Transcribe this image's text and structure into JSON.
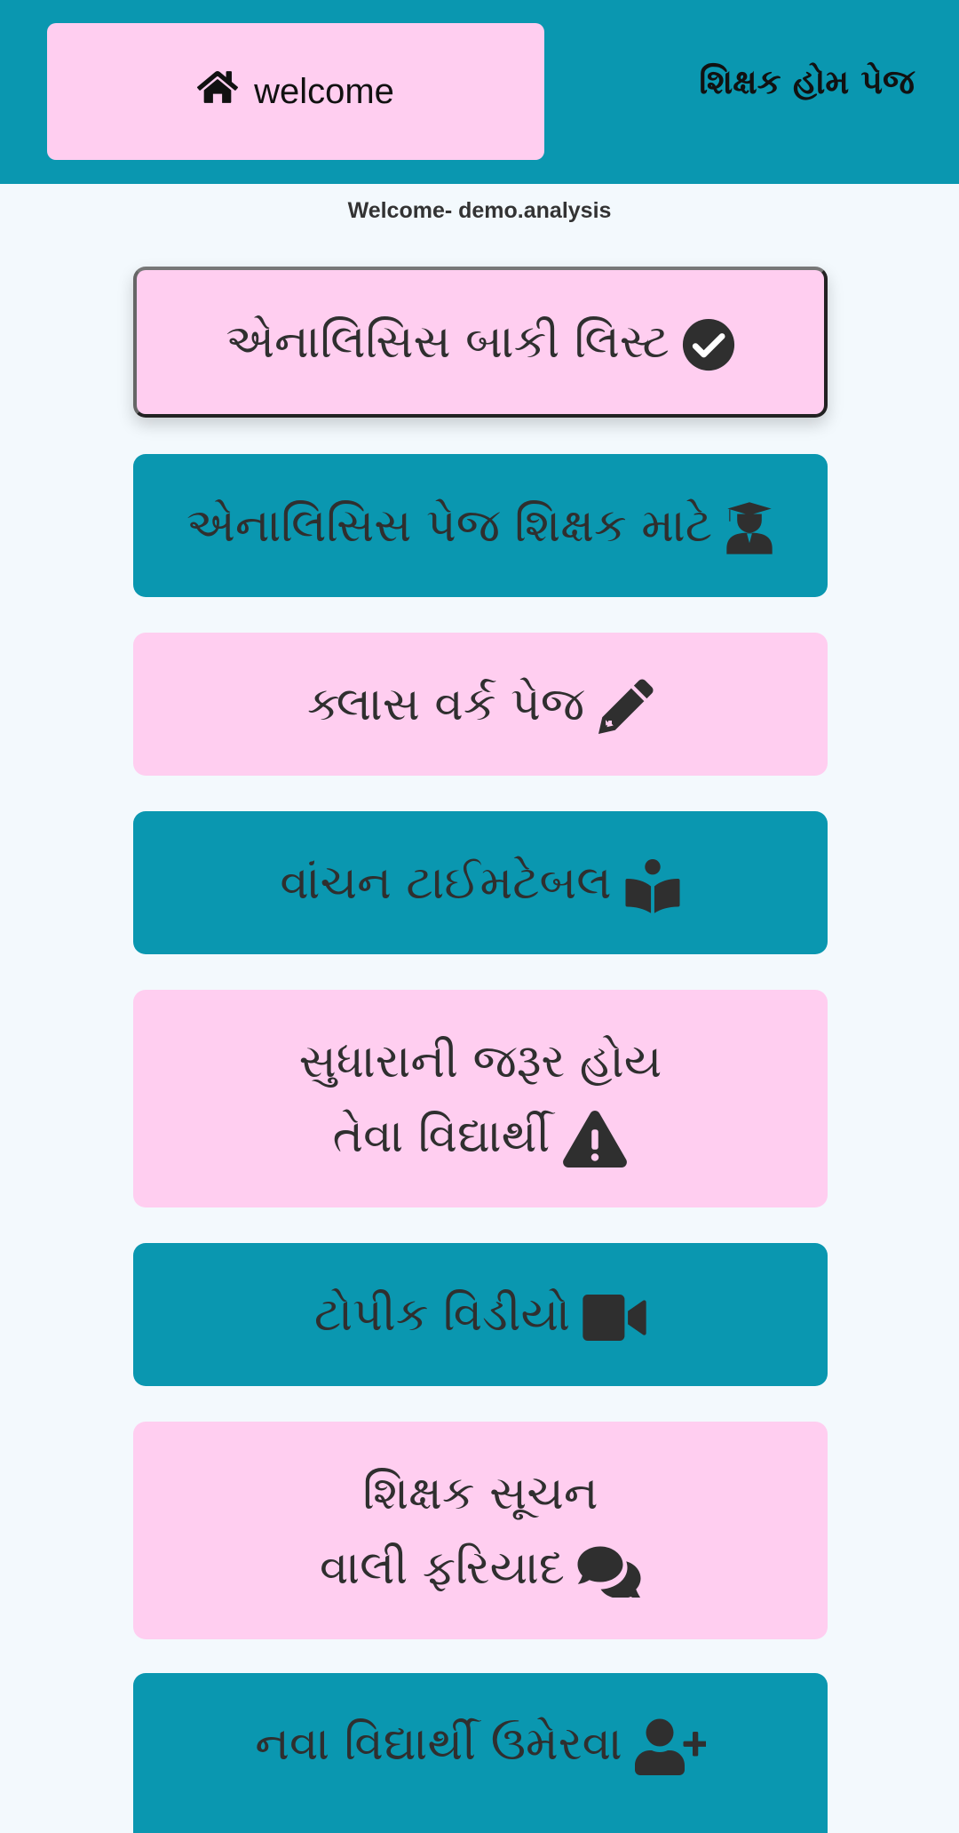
{
  "header": {
    "home_label": "welcome",
    "page_title": "શિક્ષક હોમ પેજ",
    "bg_color": "#0a97b0"
  },
  "welcome_text": "Welcome- demo.analysis",
  "menu": [
    {
      "label": "એનાલિસિસ બાકી લિસ્ટ",
      "icon": "check-circle-icon",
      "color": "#ffcef0",
      "active": true
    },
    {
      "label": "એનાલિસિસ પેજ શિક્ષક માટે",
      "icon": "graduate-user-icon",
      "color": "#0a97b0"
    },
    {
      "label": "ક્લાસ વર્ક પેજ",
      "icon": "pencil-icon",
      "color": "#ffcef0"
    },
    {
      "label": "વાંચન ટાઈમટેબલ",
      "icon": "book-reader-icon",
      "color": "#0a97b0"
    },
    {
      "line1": "સુધારાની જરૂર હોય",
      "line2": "તેવા વિદ્યાર્થી",
      "icon": "warning-icon",
      "color": "#ffcef0"
    },
    {
      "label": "ટોપીક વિડીયો",
      "icon": "video-camera-icon",
      "color": "#0a97b0"
    },
    {
      "line1": "શિક્ષક સૂચન",
      "line2": "વાલી ફરિયાદ",
      "icon": "comments-icon",
      "color": "#ffcef0"
    },
    {
      "label": "નવા વિદ્યાર્થી ઉમેરવા",
      "icon": "user-plus-icon",
      "color": "#0a97b0"
    }
  ]
}
